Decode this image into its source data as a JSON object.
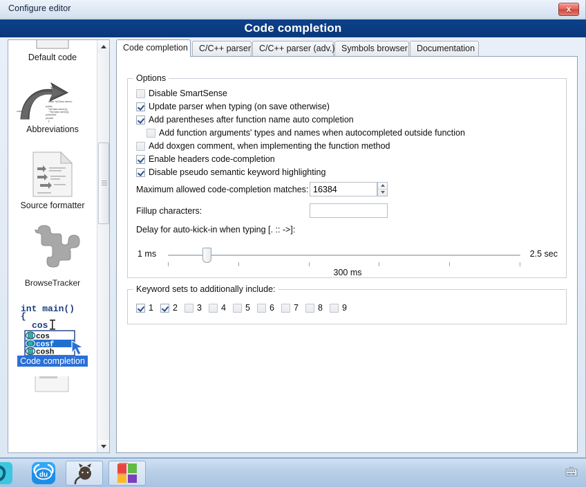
{
  "window": {
    "title": "Configure editor",
    "close_label": "x",
    "header_title": "Code completion",
    "header_color": "#0b3d82"
  },
  "sidebar": {
    "items": [
      {
        "label": "Default code",
        "icon": "document-icon",
        "selected": false,
        "clipped_top": true
      },
      {
        "label": "Abbreviations",
        "icon": "curved-arrow-code-icon",
        "selected": false
      },
      {
        "label": "Source formatter",
        "icon": "formatted-document-icon",
        "selected": false
      },
      {
        "label": "BrowseTracker",
        "icon": "puzzle-piece-icon",
        "selected": false
      },
      {
        "label": "Code completion",
        "icon": "code-completion-popup-icon",
        "selected": true
      },
      {
        "label": "",
        "icon": "document-icon",
        "selected": false,
        "clipped_bottom": true
      }
    ],
    "scrollbar": {
      "up": "▲",
      "down": "▼"
    }
  },
  "tabs": [
    {
      "label": "Code completion",
      "active": true
    },
    {
      "label": "C/C++ parser",
      "active": false
    },
    {
      "label": "C/C++ parser (adv.)",
      "active": false
    },
    {
      "label": "Symbols browser",
      "active": false
    },
    {
      "label": "Documentation",
      "active": false
    }
  ],
  "options_group": {
    "legend": "Options",
    "checkboxes": [
      {
        "label": "Disable SmartSense",
        "checked": false,
        "indent": 0
      },
      {
        "label": "Update parser when typing (on save otherwise)",
        "checked": true,
        "indent": 0
      },
      {
        "label": "Add parentheses after function name auto completion",
        "checked": true,
        "indent": 0
      },
      {
        "label": "Add function arguments' types and names when autocompleted outside function",
        "checked": false,
        "indent": 1
      },
      {
        "label": "Add doxgen comment, when implementing the function method",
        "checked": false,
        "indent": 0
      },
      {
        "label": "Enable headers code-completion",
        "checked": true,
        "indent": 0
      },
      {
        "label": "Disable pseudo semantic keyword highlighting",
        "checked": true,
        "indent": 0
      }
    ],
    "max_matches": {
      "label": "Maximum allowed code-completion matches:",
      "value": "16384",
      "placeholder": ""
    },
    "fillup": {
      "label": "Fillup characters:",
      "value": "",
      "placeholder": ""
    },
    "delay": {
      "label": "Delay for auto-kick-in when typing [. :: ->]:",
      "min_label": "1 ms",
      "max_label": "2.5 sec",
      "value_label": "300 ms",
      "value_percent": 18,
      "tick_count": 6
    }
  },
  "keyword_group": {
    "legend": "Keyword sets to additionally include:",
    "sets": [
      {
        "label": "1",
        "checked": true
      },
      {
        "label": "2",
        "checked": true
      },
      {
        "label": "3",
        "checked": false
      },
      {
        "label": "4",
        "checked": false
      },
      {
        "label": "5",
        "checked": false
      },
      {
        "label": "6",
        "checked": false
      },
      {
        "label": "7",
        "checked": false
      },
      {
        "label": "8",
        "checked": false
      },
      {
        "label": "9",
        "checked": false
      }
    ]
  },
  "taskbar": {
    "buttons": [
      {
        "name": "taskbar-app-teal",
        "icon": "teal-hook-icon",
        "framed": false
      },
      {
        "name": "taskbar-app-baidu",
        "icon": "baidu-du-icon",
        "label": "du",
        "framed": false
      },
      {
        "name": "taskbar-app-cat",
        "icon": "cat-icon",
        "framed": true
      },
      {
        "name": "taskbar-app-windows",
        "icon": "windows-squares-icon",
        "framed": true
      }
    ],
    "tray": {
      "icon": "keyboard-icon"
    }
  },
  "code_icon": {
    "line1": "int main()",
    "line2": "{",
    "line3": "cos",
    "items": [
      "cos",
      "cosf",
      "cosh"
    ],
    "selected_index": 1
  }
}
